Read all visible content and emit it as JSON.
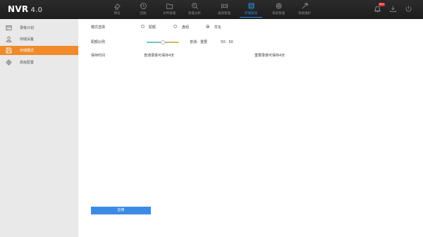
{
  "header": {
    "logo_text": "NVR",
    "logo_version": "4.0",
    "nav": [
      {
        "label": "预览",
        "icon": "camera-icon"
      },
      {
        "label": "回放",
        "icon": "playback-icon"
      },
      {
        "label": "文件管理",
        "icon": "folder-icon"
      },
      {
        "label": "智能分析",
        "icon": "analysis-icon"
      },
      {
        "label": "通道管理",
        "icon": "channel-icon"
      },
      {
        "label": "存储管理",
        "icon": "storage-icon",
        "active": true
      },
      {
        "label": "系统管理",
        "icon": "gear-icon"
      },
      {
        "label": "系统维护",
        "icon": "wrench-icon"
      }
    ],
    "alarm_badge": "99+",
    "active_color": "#2d8fe0"
  },
  "sidebar": {
    "items": [
      {
        "label": "录像计划",
        "icon": "calendar-icon"
      },
      {
        "label": "存储设备",
        "icon": "user-icon"
      },
      {
        "label": "存储模式",
        "icon": "save-icon",
        "active": true
      },
      {
        "label": "高级配置",
        "icon": "gear-icon"
      }
    ],
    "active_color": "#f08a2a"
  },
  "main": {
    "mode_label": "模式选择",
    "mode_options": [
      {
        "label": "配额",
        "checked": false
      },
      {
        "label": "盘组",
        "checked": false
      },
      {
        "label": "优化",
        "checked": true
      }
    ],
    "ratio_label": "配额比例",
    "ratio_caption": "普通：重要",
    "ratio_value": "50：50",
    "ratio_fraction": 0.5,
    "retention_label": "保存时间",
    "retention_normal": "普通录像可保存4天",
    "retention_important": "重要录像可保存4天",
    "apply_label": "应用",
    "apply_color": "#3b8be6"
  }
}
